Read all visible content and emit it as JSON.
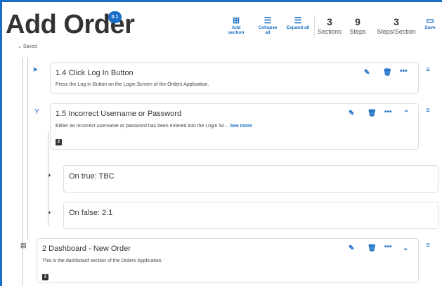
{
  "page": {
    "title": "Add Order",
    "version": "0.1",
    "saved": "Saved"
  },
  "toolbar": {
    "add_section": {
      "line1": "Add",
      "line2": "section",
      "icon": "add-section-icon"
    },
    "collapse_all": {
      "line1": "Collapse",
      "line2": "all",
      "icon": "collapse-all-icon"
    },
    "expand_all": {
      "label": "Expand all",
      "icon": "expand-all-icon"
    },
    "save": {
      "label": "Save",
      "icon": "folder-icon"
    }
  },
  "stats": {
    "sections": {
      "value": "3",
      "label": "Sections"
    },
    "steps": {
      "value": "9",
      "label": "Steps"
    },
    "steps_per_section": {
      "value": "3",
      "label": "Steps/Section"
    }
  },
  "steps": [
    {
      "title": "1.4 Click Log In Button",
      "description": "Press the Log In Button on the Login Screen of the Orders Application."
    },
    {
      "title": "1.5 Incorrect Username or Password",
      "description": "Either an incorrect username or password has been entered into the Login Sc...",
      "see_more": "See more",
      "badge": "2"
    }
  ],
  "branches": [
    {
      "label": "On true: TBC"
    },
    {
      "label": "On false: 2.1"
    }
  ],
  "section": {
    "title": "2 Dashboard - New Order",
    "description": "This is the dashboard section of the Orders Application.",
    "badge": "2"
  },
  "colors": {
    "accent": "#1a6ec5",
    "text": "#333333"
  }
}
